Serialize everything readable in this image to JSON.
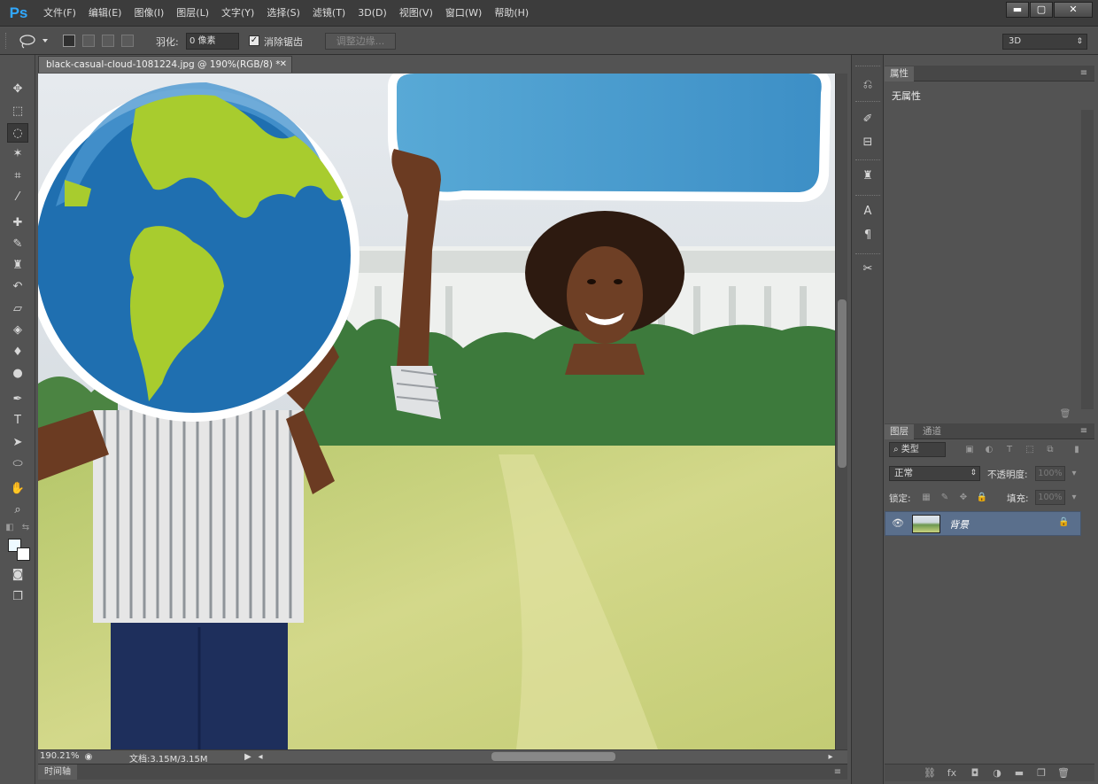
{
  "app": {
    "logo": "Ps",
    "menus": [
      "文件(F)",
      "编辑(E)",
      "图像(I)",
      "图层(L)",
      "文字(Y)",
      "选择(S)",
      "滤镜(T)",
      "3D(D)",
      "视图(V)",
      "窗口(W)",
      "帮助(H)"
    ],
    "window_controls": {
      "minimize": "▬",
      "maximize": "▢",
      "close": "✕"
    }
  },
  "options_bar": {
    "feather_label": "羽化:",
    "feather_value": "0 像素",
    "antialias_label": "消除锯齿",
    "antialias_checked": true,
    "refine_edge_label": "调整边缘...",
    "workspace": "3D"
  },
  "document": {
    "tab_title": "black-casual-cloud-1081224.jpg @ 190%(RGB/8) *",
    "zoom": "190.21%",
    "doc_size": "文档:3.15M/3.15M"
  },
  "timeline_tab": "时间轴",
  "properties_panel": {
    "tab": "属性",
    "empty_text": "无属性"
  },
  "layers_panel": {
    "tabs": [
      "图层",
      "通道"
    ],
    "filter_label": "类型",
    "blend_mode": "正常",
    "opacity_label": "不透明度:",
    "opacity_value": "100%",
    "lock_label": "锁定:",
    "fill_label": "填充:",
    "fill_value": "100%",
    "layers": [
      {
        "name": "背景",
        "visible": true,
        "locked": true
      }
    ]
  },
  "colors": {
    "foreground": "#eefaff",
    "background": "#ffffff",
    "accent": "#31a8ff"
  }
}
